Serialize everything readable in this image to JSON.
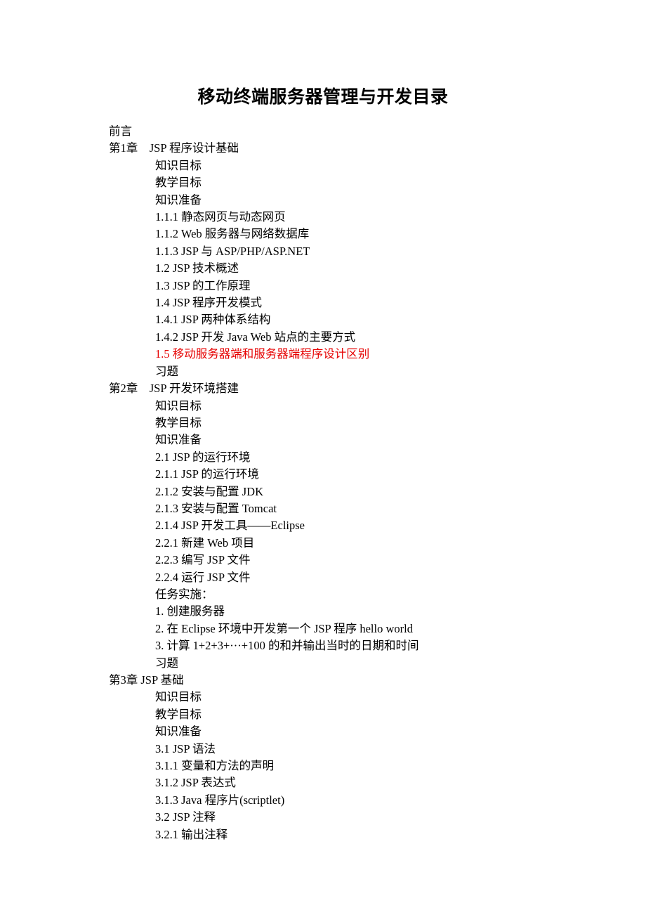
{
  "title": "移动终端服务器管理与开发目录",
  "preface": "前言",
  "chapter1": {
    "heading": "第1章　JSP 程序设计基础",
    "items": [
      "知识目标",
      "教学目标",
      "知识准备",
      "1.1.1 静态网页与动态网页",
      "1.1.2 Web 服务器与网络数据库",
      "1.1.3 JSP 与 ASP/PHP/ASP.NET",
      "1.2 JSP 技术概述",
      "1.3 JSP 的工作原理",
      "1.4 JSP 程序开发模式",
      "1.4.1 JSP 两种体系结构",
      "1.4.2 JSP 开发 Java Web 站点的主要方式"
    ],
    "highlight": "1.5 移动服务器端和服务器端程序设计区别",
    "exercises": "习题"
  },
  "chapter2": {
    "heading": "第2章　JSP 开发环境搭建",
    "items": [
      "知识目标",
      "教学目标",
      "知识准备",
      "2.1 JSP 的运行环境",
      "2.1.1 JSP 的运行环境",
      "2.1.2 安装与配置 JDK",
      "2.1.3 安装与配置 Tomcat",
      "2.1.4 JSP 开发工具——Eclipse",
      "2.2.1 新建 Web 项目",
      "2.2.3 编写 JSP 文件",
      "2.2.4 运行 JSP 文件",
      "任务实施：",
      "1. 创建服务器",
      "2. 在 Eclipse 环境中开发第一个 JSP 程序 hello world",
      "3. 计算 1+2+3+···+100 的和并输出当时的日期和时间",
      "习题"
    ]
  },
  "chapter3": {
    "heading": "第3章 JSP 基础",
    "items": [
      "知识目标",
      "教学目标",
      "知识准备",
      "3.1 JSP 语法",
      "3.1.1 变量和方法的声明",
      "3.1.2 JSP 表达式",
      "3.1.3 Java 程序片(scriptlet)",
      "3.2 JSP 注释",
      "3.2.1 输出注释"
    ]
  }
}
